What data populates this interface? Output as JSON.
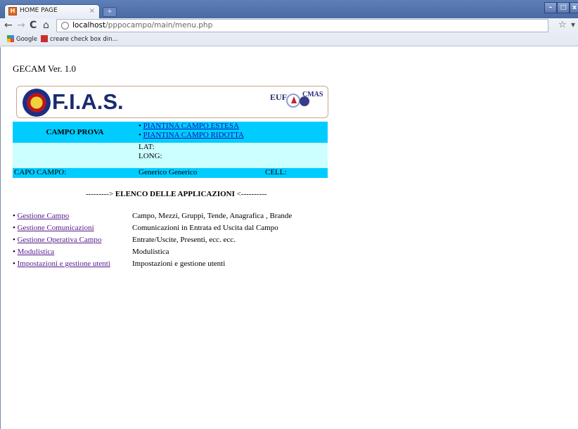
{
  "browser": {
    "tab_title": "HOME PAGE",
    "tab_close": "×",
    "new_tab": "+",
    "url_host": "localhost",
    "url_path": "/pppocampo/main/menu.php",
    "bookmarks": [
      "Google",
      "creare check box din..."
    ]
  },
  "page": {
    "version": "GECAM Ver. 1.0",
    "logo": {
      "text": "F.I.A.S.",
      "euf": "EUF",
      "cmas": "CMAS"
    },
    "campo": {
      "name": "CAMPO PROVA",
      "links": [
        "PIANTINA CAMPO ESTESA",
        "PIANTINA CAMPO RIDOTTA"
      ],
      "lat_label": "LAT:",
      "long_label": "LONG:",
      "capo_label": "CAPO CAMPO:",
      "capo_value": "Generico Generico",
      "cell_label": "CELL:"
    },
    "elenco_prefix": "---------> ",
    "elenco_title": "ELENCO DELLE APPLICAZIONI",
    "elenco_suffix": " <----------",
    "apps": [
      {
        "label": "Gestione Campo",
        "desc": "Campo, Mezzi, Gruppi, Tende, Anagrafica , Brande"
      },
      {
        "label": "Gestione Comunicazioni",
        "desc": "Comunicazioni in Entrata ed Uscita dal Campo"
      },
      {
        "label": "Gestione Operativa Campo",
        "desc": "Entrate/Uscite, Presenti, ecc. ecc."
      },
      {
        "label": "Modulistica",
        "desc": "Modulistica"
      },
      {
        "label": "Impostazioni e gestione utenti",
        "desc": "Impostazioni e gestione utenti"
      }
    ]
  }
}
